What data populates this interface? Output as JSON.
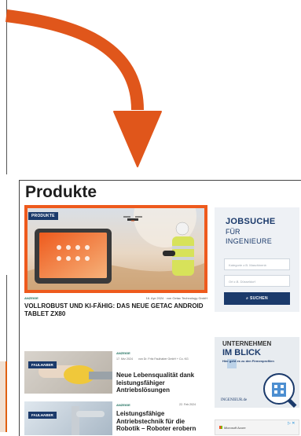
{
  "panel": {
    "title": "Produkte"
  },
  "hero": {
    "badge": "PRODUKTE",
    "label": "ANZEIGE",
    "date_author": "16. Apr 2024 · von Getac Technology GmbH",
    "headline": "VOLLROBUST UND KI-FÄHIG: DAS NEUE GETAC ANDROID TABLET ZX80"
  },
  "jobsuche": {
    "title1": "JOBSUCHE",
    "title2": "FÜR",
    "title3": "INGENIEURE",
    "keyword_placeholder": "Kategorie z.B. Maschinenb",
    "location_placeholder": "Ort z.B. Düsseldorf",
    "button": "SUCHEN"
  },
  "articles": [
    {
      "badge": "FAULHABER",
      "label": "ANZEIGE",
      "date": "17. Mrz 2024",
      "author": "von Dr. Fritz Faulhaber GmbH + Co. KG",
      "title": "Neue Lebensqualität dank leistungsfähiger Antriebslösungen"
    },
    {
      "badge": "FAULHABER",
      "label": "ANZEIGE",
      "date": "22. Feb 2024",
      "title": "Leistungsfähige Antriebstechnik für die Robotik – Roboter erobern"
    }
  ],
  "ad_unternehmen": {
    "line1": "UNTERNEHMEN",
    "line2": "IM BLICK",
    "sub": "Hier geht es zu den Firmenprofilen",
    "brand": "INGENIEUR.de"
  },
  "ad_azure": {
    "label": "Microsoft Azure",
    "ad_mark": "▷ ✕"
  },
  "colors": {
    "accent_orange": "#ee5a1d",
    "navy": "#1b3a6b",
    "green_label": "#1b6d5b"
  }
}
